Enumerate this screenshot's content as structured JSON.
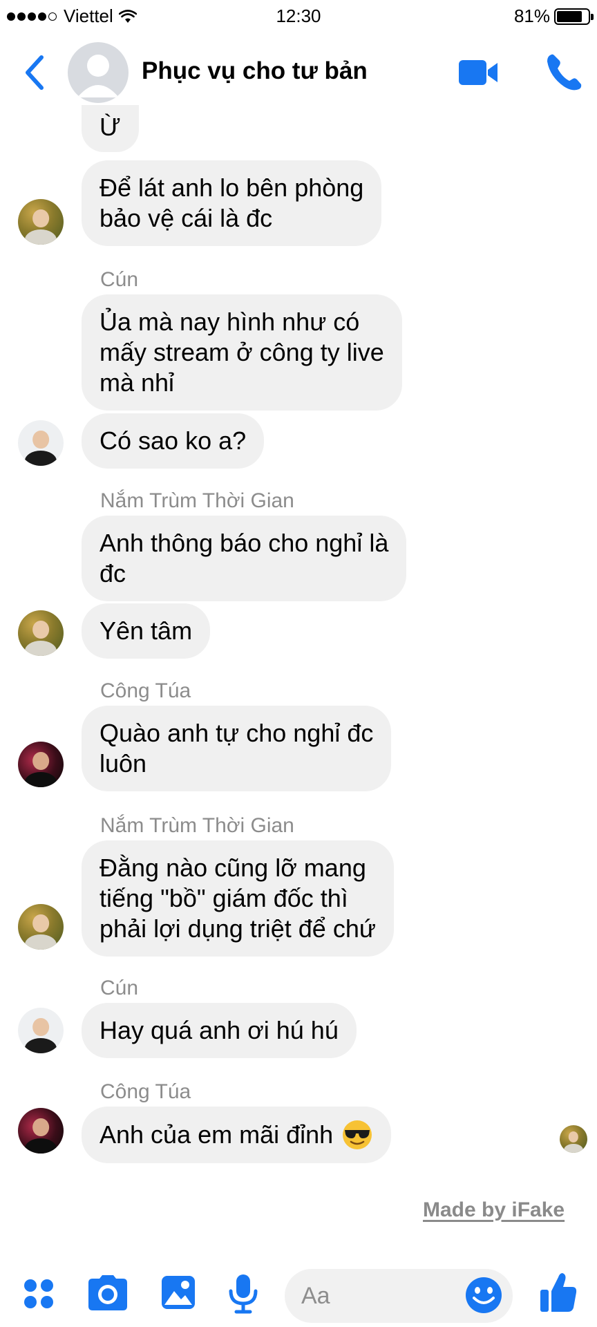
{
  "status_bar": {
    "carrier": "Viettel",
    "time": "12:30",
    "battery_percent_label": "81%",
    "battery_level": 0.81
  },
  "header": {
    "title": "Phục vụ cho tư bản"
  },
  "messages": [
    {
      "text": "Ừ"
    },
    {
      "text": "Để lát anh lo bên phòng\nbảo vệ cái là đc"
    },
    {
      "sender": "Cún"
    },
    {
      "text": "Ủa mà nay hình như có\nmấy stream ở công ty live\nmà nhỉ"
    },
    {
      "text": "Có sao ko a?"
    },
    {
      "sender": "Nắm Trùm Thời Gian"
    },
    {
      "text": "Anh thông báo cho nghỉ là\nđc"
    },
    {
      "text": "Yên tâm"
    },
    {
      "sender": "Công Túa"
    },
    {
      "text": "Quào anh tự cho nghỉ đc\nluôn"
    },
    {
      "sender": "Nắm Trùm Thời Gian"
    },
    {
      "text": "Đằng nào cũng lỡ mang\ntiếng \"bồ\" giám đốc thì\nphải lợi dụng triệt để chứ"
    },
    {
      "sender": "Cún"
    },
    {
      "text": "Hay quá anh ơi hú hú"
    },
    {
      "sender": "Công Túa"
    },
    {
      "text": "Anh của em mãi đỉnh",
      "emoji": "smiling-face-with-sunglasses"
    }
  ],
  "watermark": "Made by iFake",
  "composer": {
    "placeholder": "Aa"
  },
  "icons": {
    "back": "chevron-left-icon",
    "video": "video-camera-icon",
    "phone": "phone-icon",
    "apps": "four-dots-icon",
    "camera": "camera-icon",
    "gallery": "image-icon",
    "mic": "microphone-icon",
    "emoji": "emoji-smile-icon",
    "like": "thumbs-up-icon"
  },
  "colors": {
    "accent": "#1877f2",
    "bubble": "#f0f0f0",
    "sender_text": "#8c8c8c"
  }
}
